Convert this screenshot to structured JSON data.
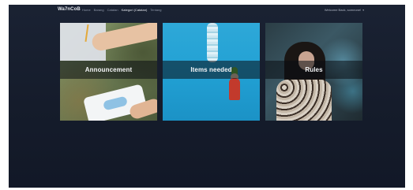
{
  "navbar": {
    "brand": "Wa7nCoB",
    "links": [
      {
        "label": "Home",
        "active": false
      },
      {
        "label": "Barang",
        "active": false
      },
      {
        "label": "Catatan",
        "active": false
      },
      {
        "label": "Kategori (Catatan)",
        "active": true
      },
      {
        "label": "Tentang",
        "active": false
      }
    ],
    "user_greeting": "Welcome Back, someone!",
    "user_caret": "▾"
  },
  "cards": [
    {
      "label": "Announcement"
    },
    {
      "label": "Items needed"
    },
    {
      "label": "Rules"
    }
  ],
  "colors": {
    "background": "#1a2233",
    "text_primary": "#f4f5f7",
    "nav_muted": "#8e97a8"
  }
}
